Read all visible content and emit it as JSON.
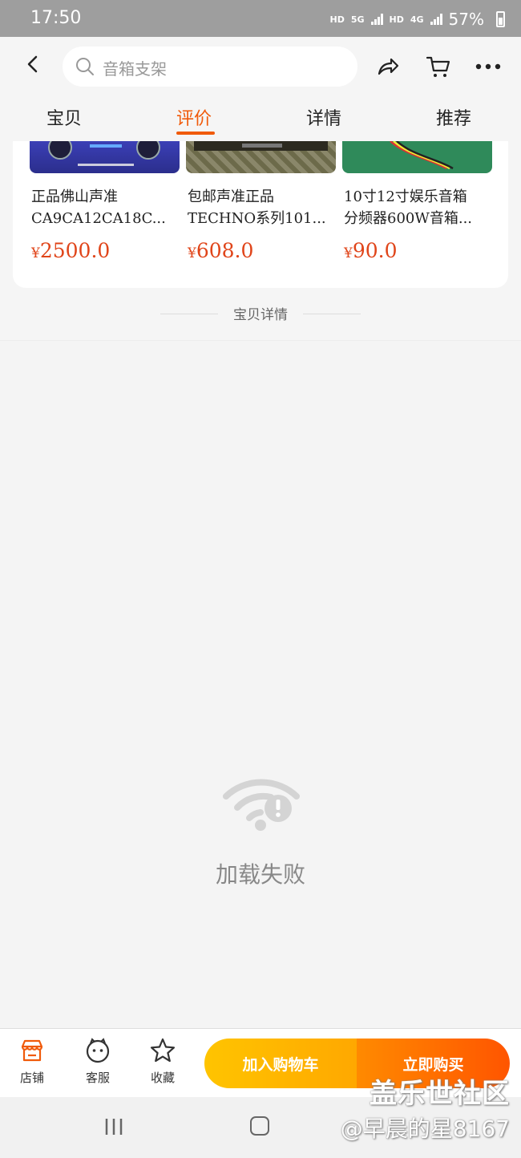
{
  "status_bar": {
    "time": "17:50",
    "hd1": "HD",
    "net1": "5G",
    "hd2": "HD",
    "net2": "4G",
    "battery": "57%"
  },
  "search": {
    "placeholder": "音箱支架"
  },
  "tabs": [
    {
      "label": "宝贝",
      "active": false
    },
    {
      "label": "评价",
      "active": true
    },
    {
      "label": "详情",
      "active": false
    },
    {
      "label": "推荐",
      "active": false
    }
  ],
  "products": [
    {
      "line1": "正品佛山声准",
      "line2": "CA9CA12CA18C...",
      "currency": "¥",
      "price": "2500.0"
    },
    {
      "line1": "包邮声准正品",
      "line2": "TECHNO系列101...",
      "currency": "¥",
      "price": "608.0"
    },
    {
      "line1": "10寸12寸娱乐音箱",
      "line2": "分频器600W音箱...",
      "currency": "¥",
      "price": "90.0"
    }
  ],
  "detail_section_title": "宝贝详情",
  "error": {
    "message": "加载失败"
  },
  "bottom_bar": {
    "store": "店铺",
    "service": "客服",
    "favorite": "收藏",
    "add_to_cart": "加入购物车",
    "buy_now": "立即购买"
  },
  "watermark": {
    "line1": "盖乐世社区",
    "line2": "@早晨的星8167"
  },
  "colors": {
    "accent": "#f05a0a",
    "price": "#e0451a",
    "cart_button": "#ffb300",
    "buy_button": "#ff6000"
  }
}
